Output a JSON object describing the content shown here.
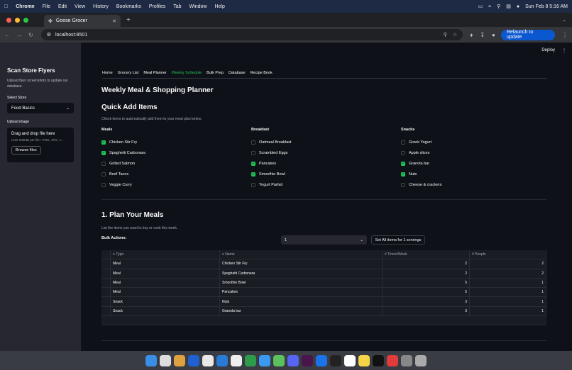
{
  "menubar": {
    "items": [
      "Chrome",
      "File",
      "Edit",
      "View",
      "History",
      "Bookmarks",
      "Profiles",
      "Tab",
      "Window",
      "Help"
    ],
    "clock": "Sun Feb 8  5:16 AM"
  },
  "browser": {
    "tab_title": "Goose Grocer",
    "url": "localhost:8501",
    "relaunch_label": "Relaunch to update"
  },
  "app": {
    "deploy_label": "Deploy",
    "sidebar": {
      "title": "Scan Store Flyers",
      "subtitle": "Upload flyer screenshots to update our database.",
      "store_label": "Select Store",
      "store_value": "Food Basics",
      "upload_label": "Upload image",
      "drop_text": "Drag and drop file here",
      "limit_text": "Limit 200MB per file • PNG, JPG, J...",
      "browse_label": "Browse files"
    },
    "tabs": [
      "Home",
      "Grocery List",
      "Meal Planner",
      "Weekly Schedule",
      "Bulk Prep",
      "Database",
      "Recipe Book"
    ],
    "active_tab": "Weekly Schedule",
    "page_title": "Weekly Meal & Shopping Planner",
    "quick_add": {
      "heading": "Quick Add Items",
      "caption": "Check items to automatically add them to your meal plan below.",
      "columns": [
        {
          "header": "Meals",
          "items": [
            {
              "label": "Chicken Stir Fry",
              "checked": true
            },
            {
              "label": "Spaghetti Carbonara",
              "checked": true
            },
            {
              "label": "Grilled Salmon",
              "checked": false
            },
            {
              "label": "Beef Tacos",
              "checked": false
            },
            {
              "label": "Veggie Curry",
              "checked": false
            }
          ]
        },
        {
          "header": "Breakfast",
          "items": [
            {
              "label": "Oatmeal Breakfast",
              "checked": false
            },
            {
              "label": "Scrambled Eggs",
              "checked": false
            },
            {
              "label": "Pancakes",
              "checked": true
            },
            {
              "label": "Smoothie Bowl",
              "checked": true
            },
            {
              "label": "Yogurt Parfait",
              "checked": false
            }
          ]
        },
        {
          "header": "Snacks",
          "items": [
            {
              "label": "Greek Yogurt",
              "checked": false
            },
            {
              "label": "Apple slices",
              "checked": false
            },
            {
              "label": "Granola bar",
              "checked": true
            },
            {
              "label": "Nuts",
              "checked": true
            },
            {
              "label": "Cheese & crackers",
              "checked": false
            }
          ]
        }
      ]
    },
    "plan": {
      "heading": "1. Plan Your Meals",
      "caption": "List the items you want to buy or cook this week.",
      "bulk_label": "Bulk Actions:",
      "bulk_value": "1",
      "bulk_button": "Set All items for 1 servings",
      "columns": [
        "Type",
        "Name",
        "Times/Week",
        "People"
      ],
      "rows": [
        [
          "Meal",
          "Chicken Stir Fry",
          "2",
          "2"
        ],
        [
          "Meal",
          "Spaghetti Carbonara",
          "2",
          "2"
        ],
        [
          "Meal",
          "Smoothie Bowl",
          "5",
          "1"
        ],
        [
          "Meal",
          "Pancakes",
          "5",
          "1"
        ],
        [
          "Snack",
          "Nuts",
          "3",
          "1"
        ],
        [
          "Snack",
          "Granola bar",
          "3",
          "1"
        ]
      ]
    }
  },
  "colors": {
    "accent": "#21c354",
    "bg": "#0e1117",
    "sidebar": "#262730",
    "button": "#0b57d0"
  }
}
